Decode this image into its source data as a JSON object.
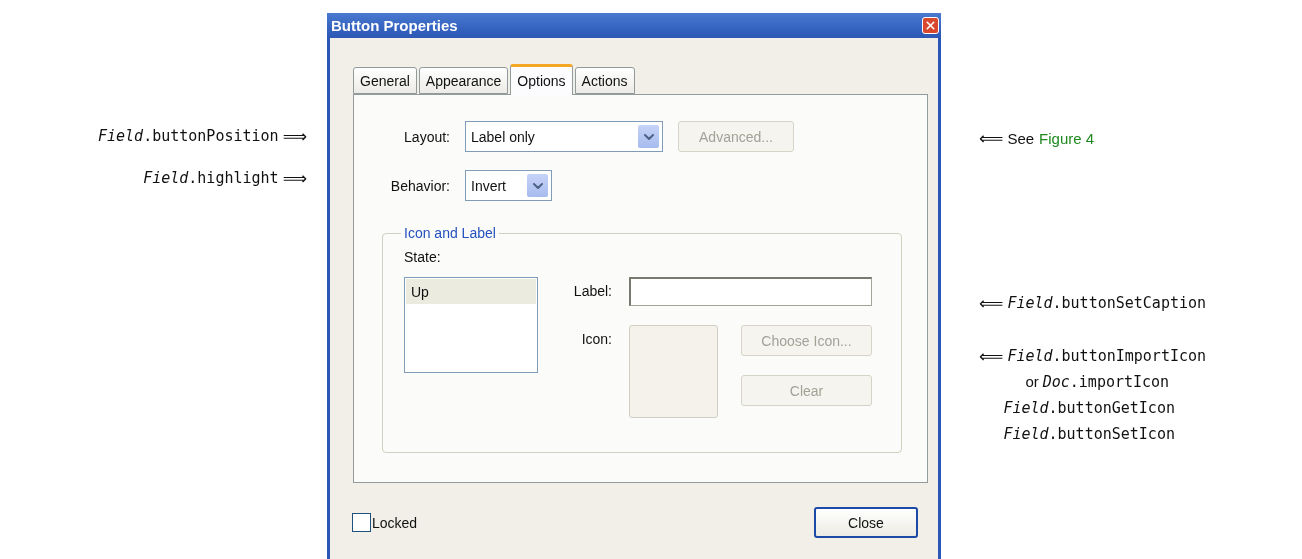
{
  "left_annotations": [
    {
      "text": "*Field*.buttonPosition",
      "arrow": "⟹"
    },
    {
      "text": "*Field*.highlight",
      "arrow": "⟹"
    }
  ],
  "dialog": {
    "title": "Button Properties",
    "tabs": [
      {
        "label": "General",
        "selected": false
      },
      {
        "label": "Appearance",
        "selected": false
      },
      {
        "label": "Options",
        "selected": true
      },
      {
        "label": "Actions",
        "selected": false
      }
    ],
    "layout": {
      "label": "Layout:",
      "value": "Label only"
    },
    "advanced_button": {
      "label": "Advanced...",
      "disabled": true
    },
    "behavior": {
      "label": "Behavior:",
      "value": "Invert"
    },
    "group": {
      "title": "Icon and Label",
      "state_label": "State:",
      "states": [
        {
          "label": "Up",
          "selected": true
        }
      ],
      "label_field": {
        "label": "Label:"
      },
      "icon": {
        "label": "Icon:"
      },
      "choose_icon_button": {
        "label": "Choose Icon...",
        "disabled": true
      },
      "clear_button": {
        "label": "Clear",
        "disabled": true
      }
    },
    "locked": {
      "label": "Locked",
      "checked": false
    },
    "close_button": {
      "label": "Close",
      "disabled": false
    }
  },
  "right_annotations": [
    {
      "arrow": "⟸",
      "lines": [
        {
          "kind": "see",
          "text": "See",
          "link": "Figure 4"
        }
      ]
    },
    {
      "arrow": "⟸",
      "lines": [
        {
          "kind": "code",
          "text": "*Field*.buttonSetCaption"
        }
      ]
    },
    {
      "arrow": "⟸",
      "lines": [
        {
          "kind": "code",
          "text": "*Field*.buttonImportIcon"
        },
        {
          "kind": "or",
          "prefix": "or",
          "text": "*Doc*.importIcon"
        },
        {
          "kind": "code",
          "text": "*Field*.buttonGetIcon"
        },
        {
          "kind": "code",
          "text": "*Field*.buttonSetIcon"
        }
      ]
    }
  ]
}
